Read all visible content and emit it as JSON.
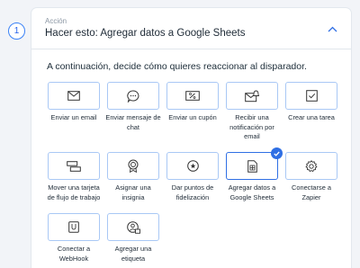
{
  "step": {
    "number": "1"
  },
  "header": {
    "label": "Acción",
    "title": "Hacer esto: Agregar datos a Google Sheets"
  },
  "prompt": "A continuación, decide cómo quieres reaccionar al disparador.",
  "colors": {
    "accent": "#2f6fe4",
    "card_border": "#a9c8f5"
  },
  "actions": [
    {
      "label": "Enviar un email",
      "icon": "envelope-icon",
      "selected": false
    },
    {
      "label": "Enviar mensaje de chat",
      "icon": "chat-bubble-icon",
      "selected": false
    },
    {
      "label": "Enviar un cupón",
      "icon": "coupon-icon",
      "selected": false
    },
    {
      "label": "Recibir una notificación por email",
      "icon": "bell-envelope-icon",
      "selected": false
    },
    {
      "label": "Crear una tarea",
      "icon": "checkbox-icon",
      "selected": false
    },
    {
      "label": "Mover una tarjeta de flujo de trabajo",
      "icon": "workflow-card-icon",
      "selected": false
    },
    {
      "label": "Asignar una insignia",
      "icon": "badge-icon",
      "selected": false
    },
    {
      "label": "Dar puntos de fidelización",
      "icon": "loyalty-points-icon",
      "selected": false
    },
    {
      "label": "Agregar datos a Google Sheets",
      "icon": "sheets-icon",
      "selected": true
    },
    {
      "label": "Conectarse a Zapier",
      "icon": "gear-icon",
      "selected": false
    },
    {
      "label": "Conectar a WebHook",
      "icon": "webhook-icon",
      "selected": false
    },
    {
      "label": "Agregar una etiqueta",
      "icon": "contact-tag-icon",
      "selected": false
    }
  ]
}
